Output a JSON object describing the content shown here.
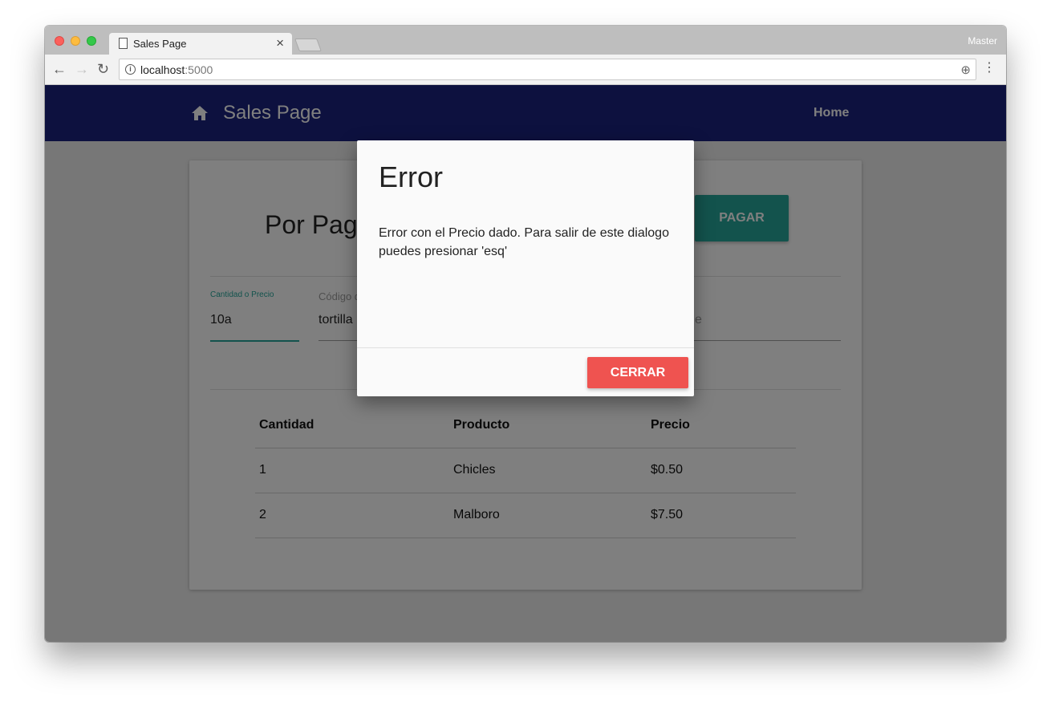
{
  "browser": {
    "tab_title": "Sales Page",
    "tab_close": "×",
    "profile_name": "Master",
    "back_icon": "←",
    "forward_icon": "→",
    "reload_icon": "↻",
    "url_host": "localhost",
    "url_port": ":5000",
    "zoom_icon": "⊕",
    "menu_icon": "⋮"
  },
  "header": {
    "brand": "Sales Page",
    "nav_home": "Home",
    "background": "#1a237e"
  },
  "card": {
    "title": "Por Pagar",
    "pay_button": "PAGAR",
    "accent": "#26a69a"
  },
  "form": {
    "quantity_label": "Cantidad o Precio",
    "quantity_value": "10a",
    "code_label": "Código d",
    "code_value": "tortilla",
    "third_placeholder": "e"
  },
  "table": {
    "headers": [
      "Cantidad",
      "Producto",
      "Precio"
    ],
    "rows": [
      [
        "1",
        "Chicles",
        "$0.50"
      ],
      [
        "2",
        "Malboro",
        "$7.50"
      ]
    ]
  },
  "modal": {
    "title": "Error",
    "body": "Error con el Precio dado. Para salir de este dialogo puedes presionar 'esq'",
    "close_button": "CERRAR",
    "close_color": "#ef5350"
  }
}
